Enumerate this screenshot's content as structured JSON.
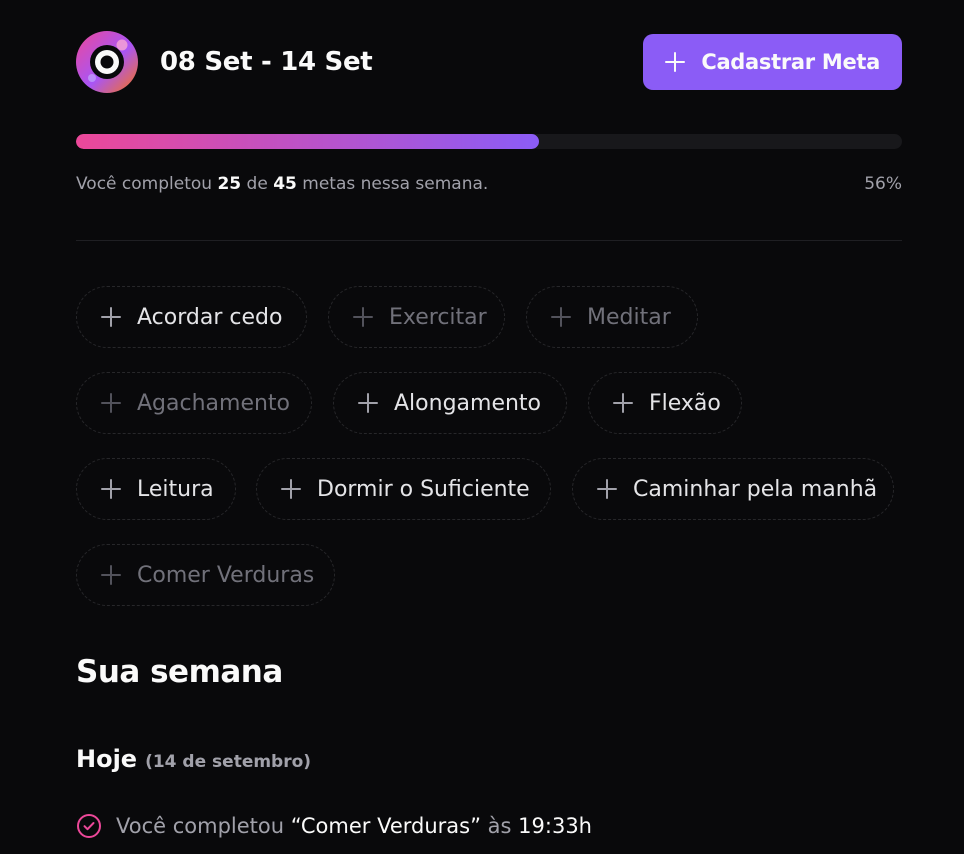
{
  "header": {
    "date_range": "08 Set - 14 Set",
    "add_goal_label": "Cadastrar Meta"
  },
  "progress": {
    "prefix": "Você completou",
    "completed": "25",
    "of": "de",
    "total": "45",
    "suffix": "metas nessa semana.",
    "percent_label": "56%",
    "fraction": 0.56,
    "gradient_start": "#ec4899",
    "gradient_end": "#8b5cf6"
  },
  "goals": [
    {
      "label": "Acordar cedo",
      "icon": "plus-icon"
    },
    {
      "label": "Exercitar",
      "icon": "plus-icon"
    },
    {
      "label": "Meditar",
      "icon": "plus-icon"
    },
    {
      "label": "Agachamento",
      "icon": "plus-icon"
    },
    {
      "label": "Alongamento",
      "icon": "plus-icon"
    },
    {
      "label": "Flexão",
      "icon": "plus-icon"
    },
    {
      "label": "Leitura",
      "icon": "plus-icon"
    },
    {
      "label": "Dormir o Suficiente",
      "icon": "plus-icon"
    },
    {
      "label": "Caminhar pela manhã",
      "icon": "plus-icon"
    },
    {
      "label": "Comer Verduras",
      "icon": "plus-icon"
    }
  ],
  "week": {
    "title": "Sua semana",
    "days": [
      {
        "name": "Hoje",
        "date": "(14 de setembro)",
        "entries": [
          {
            "prefix": "Você completou",
            "goal": "“Comer Verduras”",
            "at": "às",
            "time": "19:33h",
            "icon": "check-circle-icon"
          }
        ]
      }
    ]
  },
  "colors": {
    "accent": "#8b5cf6",
    "pink": "#ec4899",
    "background": "#09090b"
  }
}
